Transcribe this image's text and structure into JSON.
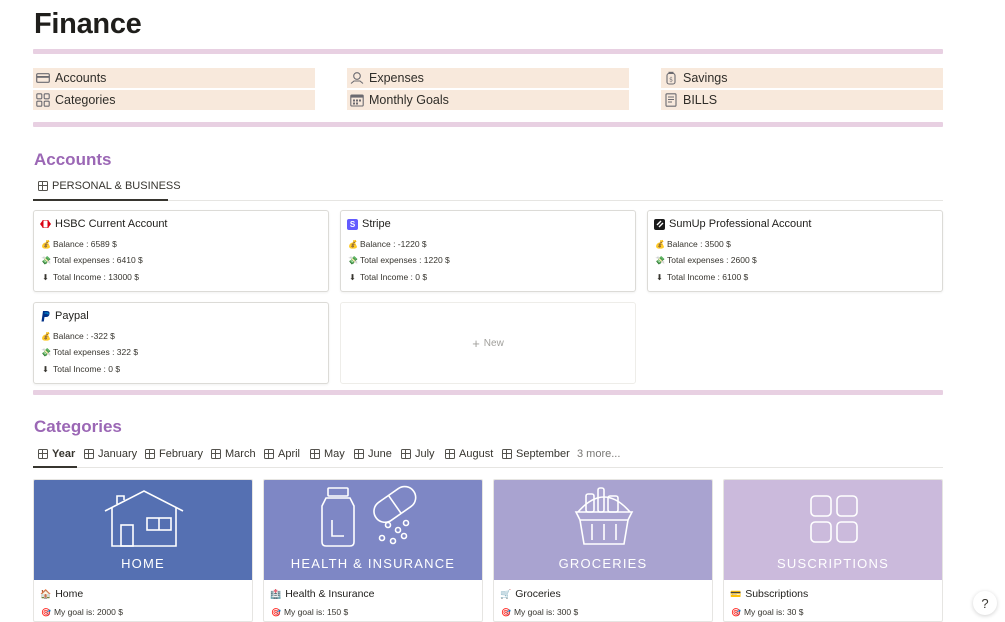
{
  "page": {
    "title": "Finance"
  },
  "nav": [
    {
      "label": "Accounts",
      "icon": "credit-card-icon"
    },
    {
      "label": "Expenses",
      "icon": "money-hand-icon"
    },
    {
      "label": "Savings",
      "icon": "piggy-jar-icon"
    },
    {
      "label": "Categories",
      "icon": "grid-squares-icon"
    },
    {
      "label": "Monthly Goals",
      "icon": "calendar-icon"
    },
    {
      "label": "BILLS",
      "icon": "receipt-icon"
    }
  ],
  "accounts": {
    "heading": "Accounts",
    "view_tab": "PERSONAL & BUSINESS",
    "new_label": "New",
    "cards": [
      {
        "name": "HSBC Current Account",
        "icon": "hsbc-logo-icon",
        "balance": "Balance : 6589 $",
        "expenses": "Total expenses : 6410 $",
        "income": "Total Income : 13000 $"
      },
      {
        "name": "Stripe",
        "icon": "stripe-logo-icon",
        "balance": "Balance : -1220 $",
        "expenses": "Total expenses : 1220 $",
        "income": "Total Income : 0 $"
      },
      {
        "name": "SumUp Professional Account",
        "icon": "sumup-logo-icon",
        "balance": "Balance : 3500 $",
        "expenses": "Total expenses : 2600 $",
        "income": "Total Income : 6100 $"
      },
      {
        "name": "Paypal",
        "icon": "paypal-logo-icon",
        "balance": "Balance : -322 $",
        "expenses": "Total expenses : 322 $",
        "income": "Total Income : 0 $"
      }
    ]
  },
  "categories": {
    "heading": "Categories",
    "tabs": [
      "Year",
      "January",
      "February",
      "March",
      "April",
      "May",
      "June",
      "July",
      "August",
      "September"
    ],
    "more": "3 more...",
    "cards": [
      {
        "cover_label": "HOME",
        "title": "Home",
        "goal": "My goal is: 2000 $",
        "color": "#5570b2"
      },
      {
        "cover_label": "HEALTH & INSURANCE",
        "title": "Health & Insurance",
        "goal": "My goal is: 150 $",
        "color": "#7e87c5"
      },
      {
        "cover_label": "GROCERIES",
        "title": "Groceries",
        "goal": "My goal is: 300 $",
        "color": "#a9a3d0"
      },
      {
        "cover_label": "SUSCRIPTIONS",
        "title": "Subscriptions",
        "goal": "My goal is: 30 $",
        "color": "#cbbadc"
      }
    ]
  },
  "help": {
    "label": "?"
  }
}
